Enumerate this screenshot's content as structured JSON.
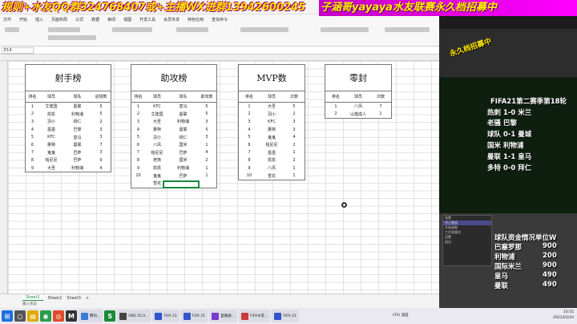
{
  "banner": {
    "left": "规则+水友QQ群324768407或+主播WX进群13942600245",
    "right": "子涵哥yayaya水友联赛永久档招募中",
    "sub": "永久档招募中"
  },
  "menu": [
    "文件",
    "开始",
    "插入",
    "页面布局",
    "公式",
    "数据",
    "审阅",
    "视图",
    "开发工具",
    "会员专享",
    "特色应用",
    "查找命令"
  ],
  "formula": {
    "cell_ref": "E14"
  },
  "tables": [
    {
      "title": "射手榜",
      "headers": [
        "排名",
        "球员",
        "球队",
        "进球数"
      ],
      "rows": [
        [
          "1",
          "艾建国",
          "曼联",
          "5"
        ],
        [
          "2",
          "凯凯",
          "利物浦",
          "5"
        ],
        [
          "3",
          "羽小",
          "拜仁",
          "2"
        ],
        [
          "4",
          "墨墨",
          "巴黎",
          "3"
        ],
        [
          "5",
          "KFC",
          "皇马",
          "3"
        ],
        [
          "6",
          "蕙特",
          "曼联",
          "7"
        ],
        [
          "7",
          "鬼鬼",
          "巴萨",
          "3"
        ],
        [
          "8",
          "帕尼尼",
          "巴萨",
          "9"
        ],
        [
          "9",
          "大圣",
          "利物浦",
          "4"
        ]
      ]
    },
    {
      "title": "助攻榜",
      "headers": [
        "排名",
        "球员",
        "球队",
        "助攻数"
      ],
      "rows": [
        [
          "1",
          "KFC",
          "皇马",
          "5"
        ],
        [
          "2",
          "艾建国",
          "曼联",
          "5"
        ],
        [
          "3",
          "大圣",
          "利物浦",
          "3"
        ],
        [
          "4",
          "蕙特",
          "曼联",
          "5"
        ],
        [
          "5",
          "羽小",
          "拜仁",
          "3"
        ],
        [
          "6",
          "八风",
          "国米",
          "1"
        ],
        [
          "7",
          "帕尼尼",
          "巴萨",
          "4"
        ],
        [
          "8",
          "老熊",
          "国米",
          "2"
        ],
        [
          "9",
          "凯凯",
          "利物浦",
          "1"
        ],
        [
          "10",
          "鬼鬼",
          "巴萨",
          "1"
        ],
        [
          "",
          "雪花",
          "",
          ""
        ]
      ]
    },
    {
      "title": "MVP数",
      "headers": [
        "排名",
        "球员",
        "次数"
      ],
      "rows": [
        [
          "1",
          "大圣",
          "5"
        ],
        [
          "2",
          "羽小",
          "2"
        ],
        [
          "3",
          "KFC",
          "3"
        ],
        [
          "4",
          "蕙特",
          "3"
        ],
        [
          "5",
          "鬼鬼",
          "4"
        ],
        [
          "6",
          "帕尼尼",
          "2"
        ],
        [
          "7",
          "墨墨",
          "1"
        ],
        [
          "8",
          "凯凯",
          "2"
        ],
        [
          "9",
          "八风",
          "1"
        ],
        [
          "10",
          "雪花",
          "1"
        ]
      ]
    },
    {
      "title": "零封",
      "headers": [
        "排名",
        "球员",
        "次数"
      ],
      "rows": [
        [
          "1",
          "八风",
          "7"
        ],
        [
          "2",
          "山猎成人",
          "1"
        ]
      ]
    }
  ],
  "sheet_tabs": [
    "Sheet1",
    "Sheet2",
    "Sheet3"
  ],
  "status_text": "输入状态",
  "overlay": {
    "league_title": "FIFA21第二赛季第18轮",
    "matches": [
      "热刺 1-0 米兰",
      "老骚 巴黎",
      "球队 0-1 曼城",
      "国米 利物浦",
      "曼联 1-1 皇马",
      "多特 0-0 拜仁"
    ],
    "funds_title": "球队资金情况单位W",
    "funds": [
      {
        "team": "巴塞罗那",
        "value": "900"
      },
      {
        "team": "利物浦",
        "value": "200"
      },
      {
        "team": "国际米兰",
        "value": "900"
      },
      {
        "team": "皇马",
        "value": "490"
      },
      {
        "team": "曼联",
        "value": "490"
      }
    ],
    "obs_items": [
      "场景",
      "停止播放",
      "开始录制",
      "工作室模式",
      "设置",
      "退出"
    ]
  },
  "taskbar": {
    "apps": [
      "腾讯...",
      "OBS 25.0...",
      "FIFA 21",
      "FIFA 21",
      "直播通...",
      "FIFA水友...",
      "FIFA 21"
    ],
    "time": "10:55",
    "date": "2021/03/24",
    "cpu": "CPU 温度"
  }
}
